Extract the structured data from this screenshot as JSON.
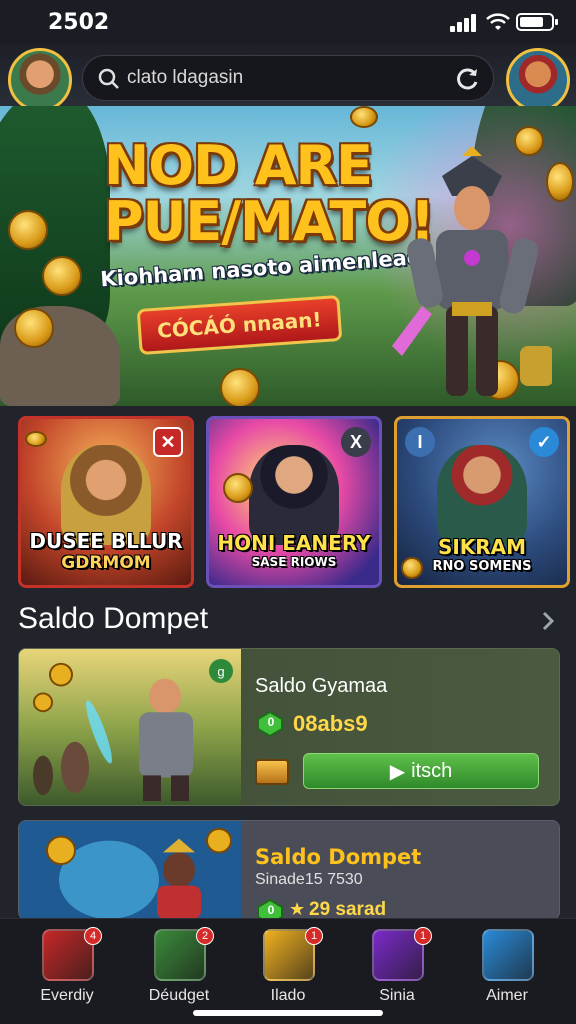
{
  "status_bar": {
    "time": "2502",
    "battery_level": 0.75
  },
  "header": {
    "search": {
      "value": "clato ldagasin",
      "placeholder": ""
    }
  },
  "hero": {
    "title_line1": "NOD ARE",
    "title_line2": "PUE/MATO!",
    "subtitle": "Kiohham nasoto aimenleaci",
    "cta": "CÓCÁÓ nnaan!",
    "slides_total": 4,
    "slide_active": 1
  },
  "game_cards": [
    {
      "title": "DUSEE BLLUR",
      "subtitle": "GDRMOM",
      "badge": "✕",
      "badge_color": "#c62828"
    },
    {
      "title": "HONI EANERY",
      "subtitle": "SASE RIOWS",
      "badge": "X",
      "badge_color": "#3a3d4a"
    },
    {
      "title": "SIKRAM",
      "subtitle": "RNO SOMENS",
      "badge": "I",
      "badge_color": "#3b6fb0"
    }
  ],
  "section": {
    "title": "Saldo Dompet"
  },
  "wallet_cards": [
    {
      "label": "Saldo Gyamaa",
      "gem_count": "0",
      "value": "08abs9",
      "action_label": "itsch",
      "action_icon": "play-icon",
      "corner_badge": "g"
    },
    {
      "label": "Saldo Dompet",
      "sub": "Sinade15 7530",
      "gem_count": "0",
      "value": "29 sarad"
    }
  ],
  "bottom_nav": [
    {
      "label": "Everdiy",
      "badge": "4",
      "color": "#c62828"
    },
    {
      "label": "Déudget",
      "badge": "2",
      "color": "#3a8a3a"
    },
    {
      "label": "Ilado",
      "badge": "1",
      "color": "#f0b020"
    },
    {
      "label": "Sinia",
      "badge": "1",
      "color": "#7a2ac8"
    },
    {
      "label": "Aimer",
      "badge": "",
      "color": "#2a8ad8"
    }
  ]
}
